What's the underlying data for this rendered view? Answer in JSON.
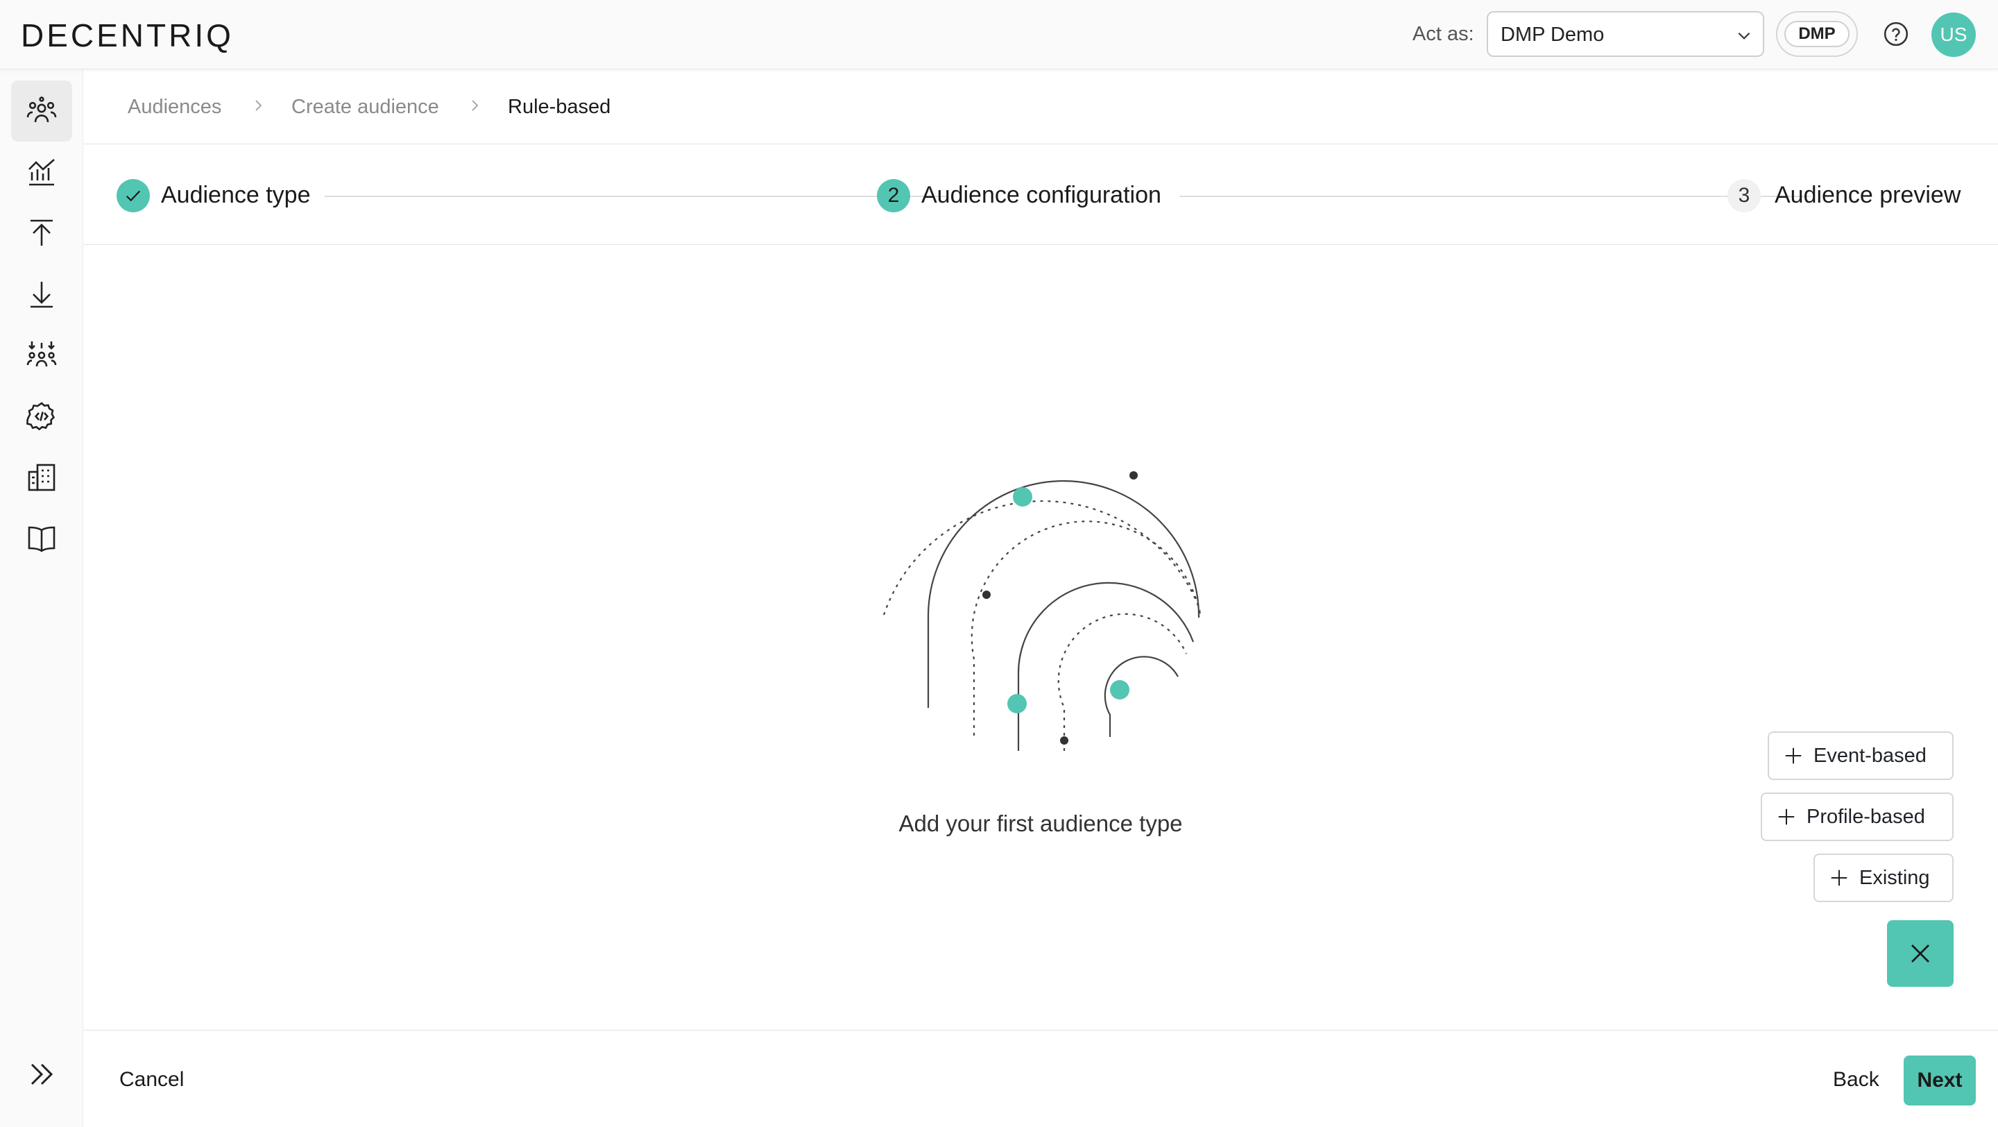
{
  "header": {
    "logo": "DECENTRIQ",
    "act_as_label": "Act as:",
    "act_as_value": "DMP Demo",
    "dmp_badge": "DMP",
    "avatar_initials": "US"
  },
  "sidebar": {
    "items": [
      {
        "icon": "audiences-icon",
        "active": true
      },
      {
        "icon": "insights-chart-icon",
        "active": false
      },
      {
        "icon": "upload-icon",
        "active": false
      },
      {
        "icon": "download-icon",
        "active": false
      },
      {
        "icon": "audience-merge-icon",
        "active": false
      },
      {
        "icon": "settings-code-icon",
        "active": false
      },
      {
        "icon": "organizations-icon",
        "active": false
      },
      {
        "icon": "documentation-book-icon",
        "active": false
      }
    ],
    "expand_icon": "double-chevron-right-icon"
  },
  "breadcrumb": {
    "items": [
      "Audiences",
      "Create audience",
      "Rule-based"
    ]
  },
  "stepper": {
    "steps": [
      {
        "number": "",
        "label": "Audience type",
        "state": "done"
      },
      {
        "number": "2",
        "label": "Audience configuration",
        "state": "active"
      },
      {
        "number": "3",
        "label": "Audience preview",
        "state": "todo"
      }
    ]
  },
  "main": {
    "empty_message": "Add your first audience type"
  },
  "fab_menu": {
    "options": [
      "Event-based",
      "Profile-based",
      "Existing"
    ]
  },
  "footer": {
    "cancel_label": "Cancel",
    "back_label": "Back",
    "next_label": "Next"
  },
  "colors": {
    "accent": "#52c6b2",
    "text": "#1f2328",
    "muted": "#8a8a8a",
    "border": "#d6d6d6"
  }
}
